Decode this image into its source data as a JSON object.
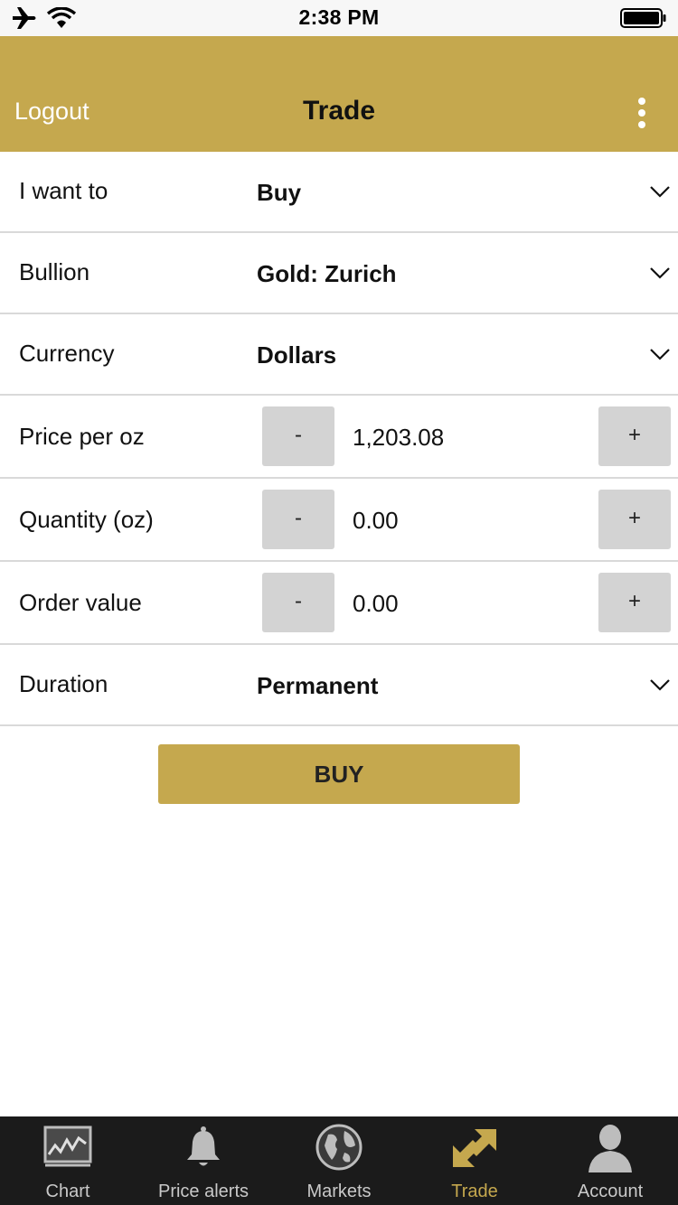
{
  "status": {
    "time": "2:38 PM"
  },
  "nav": {
    "logout": "Logout",
    "title": "Trade"
  },
  "form": {
    "want": {
      "label": "I want to",
      "value": "Buy"
    },
    "bullion": {
      "label": "Bullion",
      "value": "Gold: Zurich"
    },
    "currency": {
      "label": "Currency",
      "value": "Dollars"
    },
    "price": {
      "label": "Price per oz",
      "value": "1,203.08",
      "minus": "-",
      "plus": "+"
    },
    "quantity": {
      "label": "Quantity (oz)",
      "value": "0.00",
      "minus": "-",
      "plus": "+"
    },
    "order": {
      "label": "Order value",
      "value": "0.00",
      "minus": "-",
      "plus": "+"
    },
    "duration": {
      "label": "Duration",
      "value": "Permanent"
    }
  },
  "buy_button": "BUY",
  "tabs": [
    {
      "label": "Chart",
      "icon": "chart-icon"
    },
    {
      "label": "Price alerts",
      "icon": "bell-icon"
    },
    {
      "label": "Markets",
      "icon": "globe-icon"
    },
    {
      "label": "Trade",
      "icon": "trade-arrows-icon"
    },
    {
      "label": "Account",
      "icon": "person-icon"
    }
  ],
  "active_tab": "Trade",
  "colors": {
    "accent": "#c5a84e",
    "tabbar": "#1b1b1b",
    "stepper": "#d3d3d3"
  }
}
